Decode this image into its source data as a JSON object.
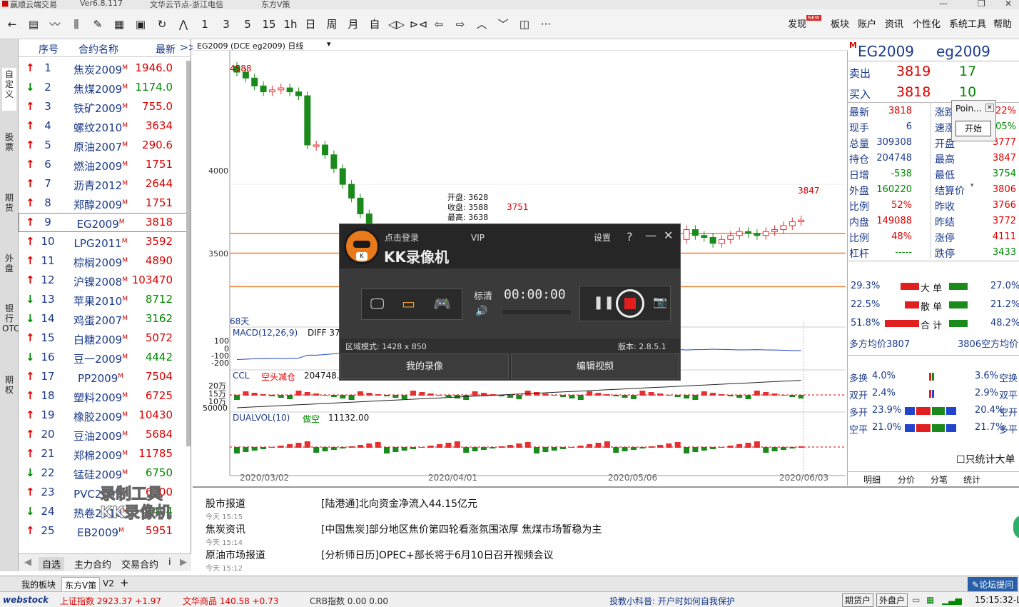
{
  "titlebar": {
    "app": "赢顺云端交易",
    "version": "Ver6.8.117",
    "server": "文华云节点-浙江电信",
    "broker": "东方V策"
  },
  "toolbar": {
    "period_items": [
      "1",
      "3",
      "5",
      "15",
      "1h",
      "日",
      "周",
      "月",
      "自"
    ],
    "right_menu": [
      "发现",
      "板块",
      "账户",
      "资讯",
      "个性化",
      "系统工具",
      "帮助"
    ],
    "new_badge": "NEW",
    "more": "···"
  },
  "left_tabs": [
    "自定义",
    "股票",
    "期货",
    "外盘",
    "银行OTC",
    "期权"
  ],
  "watchlist": {
    "headers": {
      "idx": "序号",
      "name": "合约名称",
      "last": "最新",
      "more": ">>"
    },
    "rows": [
      {
        "i": "1",
        "name": "焦炭2009",
        "px": "1946.0",
        "dir": "up"
      },
      {
        "i": "2",
        "name": "焦煤2009",
        "px": "1174.0",
        "dir": "dn"
      },
      {
        "i": "3",
        "name": "铁矿2009",
        "px": "755.0",
        "dir": "up"
      },
      {
        "i": "4",
        "name": "螺纹2010",
        "px": "3634",
        "dir": "up"
      },
      {
        "i": "5",
        "name": "原油2007",
        "px": "290.6",
        "dir": "up"
      },
      {
        "i": "6",
        "name": "燃油2009",
        "px": "1751",
        "dir": "up"
      },
      {
        "i": "7",
        "name": "沥青2012",
        "px": "2644",
        "dir": "up"
      },
      {
        "i": "8",
        "name": "郑醇2009",
        "px": "1751",
        "dir": "up"
      },
      {
        "i": "9",
        "name": "EG2009",
        "px": "3818",
        "dir": "up"
      },
      {
        "i": "10",
        "name": "LPG2011",
        "px": "3592",
        "dir": "up"
      },
      {
        "i": "11",
        "name": "棕榈2009",
        "px": "4890",
        "dir": "up"
      },
      {
        "i": "12",
        "name": "沪镍2008",
        "px": "103470",
        "dir": "up"
      },
      {
        "i": "13",
        "name": "苹果2010",
        "px": "8712",
        "dir": "dn"
      },
      {
        "i": "14",
        "name": "鸡蛋2007",
        "px": "3162",
        "dir": "dn"
      },
      {
        "i": "15",
        "name": "白糖2009",
        "px": "5072",
        "dir": "up"
      },
      {
        "i": "16",
        "name": "豆一2009",
        "px": "4442",
        "dir": "dn"
      },
      {
        "i": "17",
        "name": "PP2009",
        "px": "7504",
        "dir": "up"
      },
      {
        "i": "18",
        "name": "塑料2009",
        "px": "6725",
        "dir": "up"
      },
      {
        "i": "19",
        "name": "橡胶2009",
        "px": "10430",
        "dir": "up"
      },
      {
        "i": "20",
        "name": "豆油2009",
        "px": "5684",
        "dir": "up"
      },
      {
        "i": "21",
        "name": "郑棉2009",
        "px": "11785",
        "dir": "up"
      },
      {
        "i": "22",
        "name": "锰硅2009",
        "px": "6750",
        "dir": "dn"
      },
      {
        "i": "23",
        "name": "PVC2009",
        "px": "6300",
        "dir": "up"
      },
      {
        "i": "24",
        "name": "热卷2010",
        "px": "3474",
        "dir": "dn"
      },
      {
        "i": "25",
        "name": "EB2009",
        "px": "5951",
        "dir": "up"
      }
    ],
    "sup": "M",
    "bottom_tabs": [
      "自选",
      "主力合约",
      "交易合约",
      "i"
    ]
  },
  "chart": {
    "header": "EG2009  (DCE eg2009)  日线",
    "y_ticks": [
      "4000",
      "3500"
    ],
    "x_ticks": [
      "2020/03/02",
      "2020/04/01",
      "2020/05/06",
      "2020/06/03"
    ],
    "high_label": "4588",
    "recent_high": "3847",
    "mid_label": "3751",
    "days": "68天",
    "ohlc": {
      "open": "开盘: 3628",
      "close": "收盘: 3588",
      "high": "最高: 3638"
    },
    "macd": "MACD(12,26,9)",
    "macd_diff": "DIFF 37",
    "macd_ticks": [
      "100",
      "0",
      "-100",
      "-200"
    ],
    "ccl": "CCL",
    "ccl_state": "空头减仓",
    "ccl_val": "204748.",
    "ccl_ticks": [
      "20万",
      "15万",
      "10万",
      "50000"
    ],
    "dualvol": "DUALVOL(10)",
    "dual_state": "做空",
    "dual_val": "11132.00"
  },
  "chart_data": {
    "type": "candlestick",
    "x_range": [
      "2020/03/02",
      "2020/06/03"
    ],
    "ylim": [
      3300,
      4650
    ],
    "reference_lines": [
      3751,
      3650,
      3480
    ],
    "close_approx": [
      4570,
      4540,
      4500,
      4470,
      4480,
      4490,
      4470,
      4450,
      4200,
      4200,
      4150,
      4080,
      4000,
      3930,
      3850,
      3780,
      3720,
      3760,
      3700,
      3650,
      3620,
      3640,
      3600,
      3620,
      3590,
      3610,
      3580,
      3640,
      3620,
      3650,
      3640,
      3660,
      3630,
      3620,
      3640,
      3700,
      3680,
      3740,
      3740,
      3720,
      3700,
      3720,
      3700,
      3690,
      3640,
      3660,
      3700,
      3700,
      3720,
      3700,
      3720,
      3770,
      3740,
      3730,
      3700,
      3720,
      3740,
      3760,
      3750,
      3740,
      3760,
      3770,
      3790,
      3810,
      3818
    ]
  },
  "quote": {
    "code1": "EG2009",
    "code2": "eg2009",
    "ask_label": "卖出",
    "ask": "3819",
    "ask_vol": "17",
    "bid_label": "买入",
    "bid": "3818",
    "bid_vol": "10",
    "left": [
      [
        "最新",
        "3818"
      ],
      [
        "现手",
        "6"
      ],
      [
        "总量",
        "309308"
      ],
      [
        "持仓",
        "204748"
      ],
      [
        "日增",
        "-538"
      ],
      [
        "外盘",
        "160220"
      ],
      [
        "比例",
        "52%"
      ],
      [
        "内盘",
        "149088"
      ],
      [
        "比例",
        "48%"
      ],
      [
        "杠杆",
        "-----"
      ]
    ],
    "right": [
      [
        "涨跌",
        "22%"
      ],
      [
        "速涨",
        "05%"
      ],
      [
        "开盘",
        "3777"
      ],
      [
        "最高",
        "3847"
      ],
      [
        "最低",
        "3754"
      ],
      [
        "结算价",
        "3806"
      ],
      [
        "昨收",
        "3766"
      ],
      [
        "昨结",
        "3772"
      ],
      [
        "涨停",
        "4111"
      ],
      [
        "跌停",
        "3433"
      ]
    ],
    "flow": [
      [
        "29.3%",
        "大 单",
        "27.0%"
      ],
      [
        "22.5%",
        "散 单",
        "21.2%"
      ],
      [
        "51.8%",
        "合 计",
        "48.2%"
      ]
    ],
    "avg_long": "多方均价3807",
    "avg_short": "3806空方均价",
    "stats": [
      [
        "多换",
        "4.0%",
        "3.6%",
        "空换"
      ],
      [
        "双开",
        "2.4%",
        "2.9%",
        "双平"
      ],
      [
        "多开",
        "23.9%",
        "20.4%",
        "空开"
      ],
      [
        "空平",
        "21.0%",
        "21.7%",
        "多平"
      ]
    ],
    "big_only": "只统计大单",
    "tabs": [
      "明细",
      "分价",
      "分笔",
      "统计"
    ]
  },
  "popup": {
    "title": "Poin...",
    "button": "开始"
  },
  "news": [
    {
      "src": "股市报道",
      "time": "今天 15:15",
      "text": "[陆港通]北向资金净流入44.15亿元"
    },
    {
      "src": "焦炭资讯",
      "time": "今天 15:14",
      "text": "[中国焦炭]部分地区焦价第四轮看涨氛围浓厚 焦煤市场暂稳为主"
    },
    {
      "src": "原油市场报道",
      "time": "今天 15:12",
      "text": "[分析师日历]OPEC+部长将于6月10日召开视频会议"
    }
  ],
  "bottom_tabs": [
    "我的板块",
    "东方V策",
    "V2",
    "+"
  ],
  "forum": "论坛提问",
  "status": {
    "logo": "webstock",
    "sh": "上证指数 2923.37 +1.97",
    "wh": "文华商品 140.58 +0.73",
    "crb": "CRB指数 0.00 0.00",
    "tip": "投教小科普: 开户时如何自我保护",
    "btn1": "期货户",
    "btn2": "外盘户",
    "time": "15:15:32-Local"
  },
  "kk": {
    "login": "点击登录",
    "vip": "VIP",
    "settings": "设置",
    "help": "?",
    "brand": "KK录像机",
    "mode_label": "标清",
    "timer": "00:00:00",
    "region": "区域模式: 1428 x 850",
    "version": "版本: 2.8.5.1",
    "btn1": "我的录像",
    "btn2": "编辑视频"
  },
  "watermark": {
    "line1": "录制工具",
    "line2": "KK录像机"
  },
  "colors": {
    "up": "#d00000",
    "down": "#008000",
    "candle_up": "#e53030",
    "candle_dn": "#1a8a1a",
    "orange_line": "#f08030",
    "kk_red": "#e02020"
  }
}
